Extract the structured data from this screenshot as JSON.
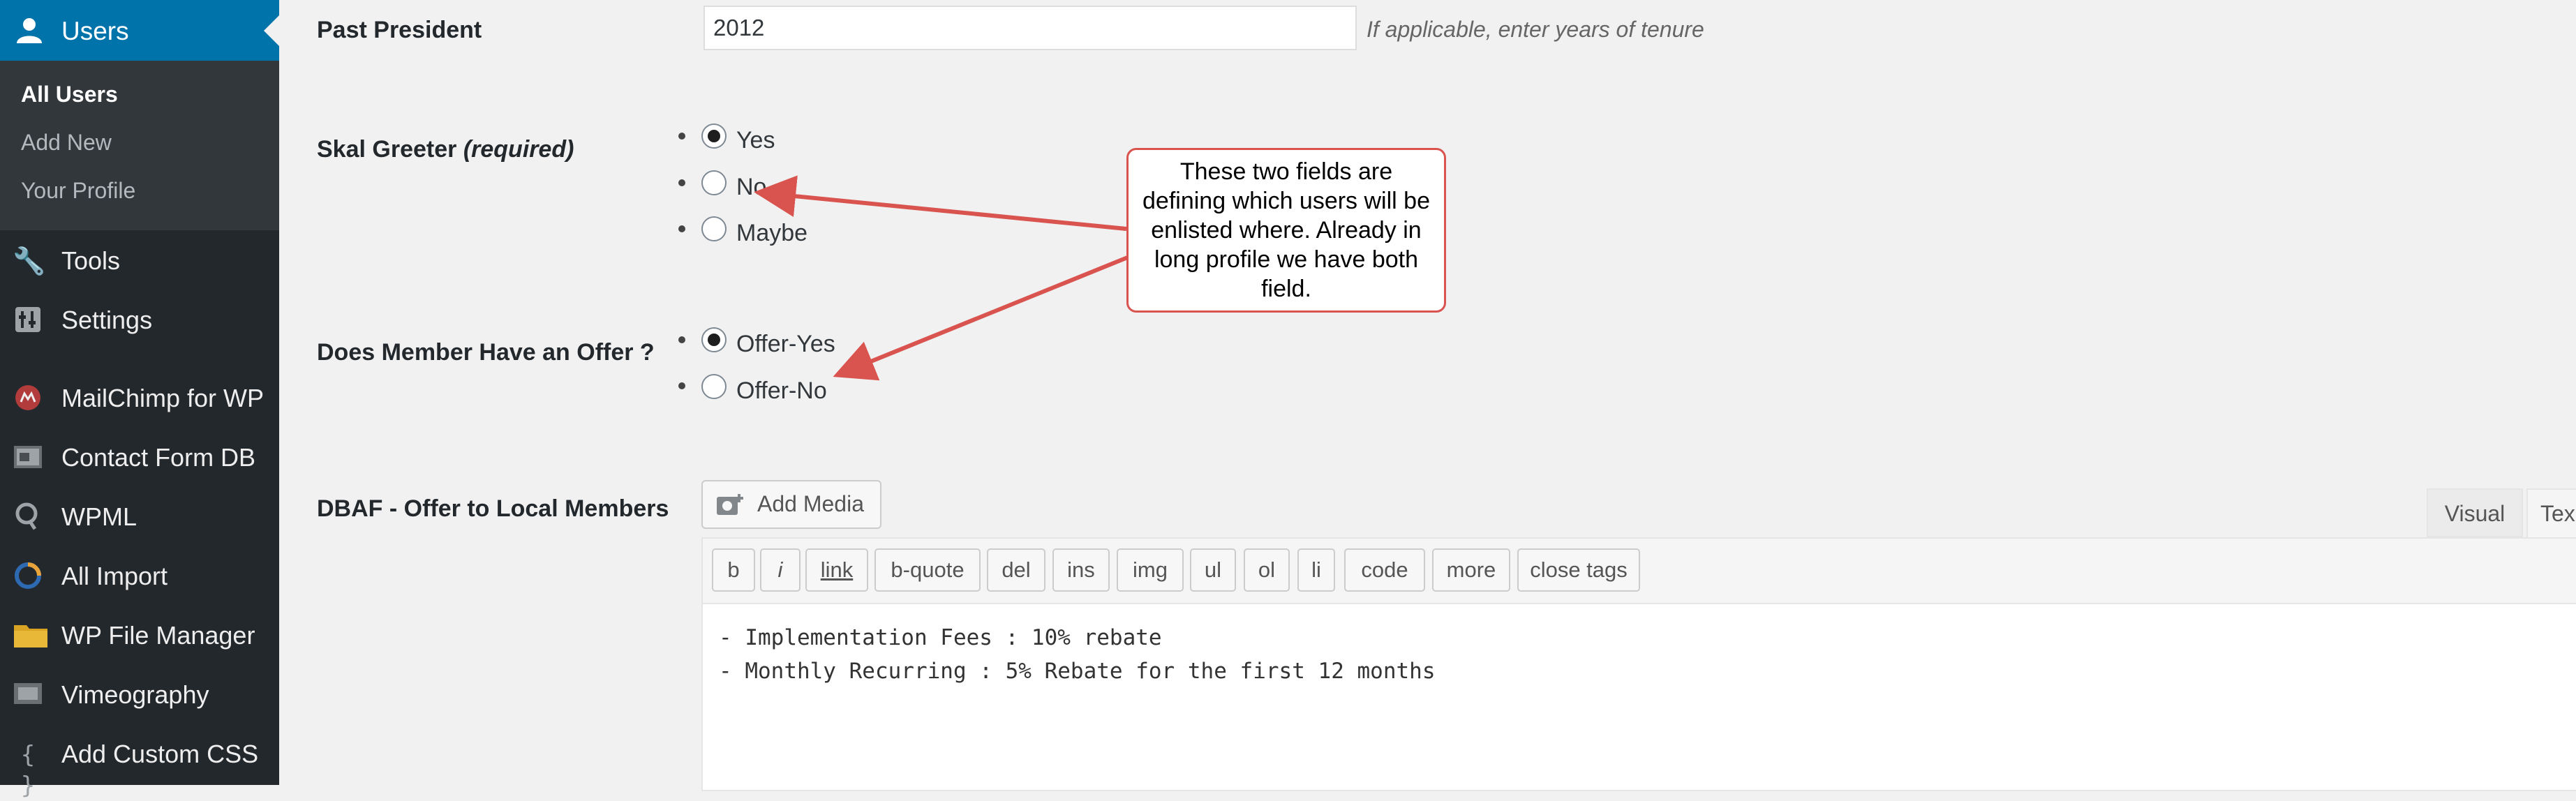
{
  "sidebar": {
    "users_label": "Users",
    "submenu": [
      "All Users",
      "Add New",
      "Your Profile"
    ],
    "items": [
      {
        "label": "Tools",
        "icon": "wrench-icon"
      },
      {
        "label": "Settings",
        "icon": "settings-sliders-icon"
      },
      {
        "label": "MailChimp for WP",
        "icon": "mailchimp-icon"
      },
      {
        "label": "Contact Form DB",
        "icon": "contact-form-db-icon"
      },
      {
        "label": "WPML",
        "icon": "wpml-icon"
      },
      {
        "label": "All Import",
        "icon": "all-import-icon"
      },
      {
        "label": "WP File Manager",
        "icon": "folder-icon"
      },
      {
        "label": "Vimeography",
        "icon": "vimeography-icon"
      },
      {
        "label": "Add Custom CSS",
        "icon": "braces-icon"
      }
    ]
  },
  "form": {
    "past_president": {
      "label": "Past President",
      "value": "2012",
      "hint": "If applicable, enter years of tenure"
    },
    "skal_greeter": {
      "label": "Skal Greeter",
      "required": "(required)",
      "options": [
        "Yes",
        "No",
        "Maybe"
      ],
      "selected": "Yes"
    },
    "member_offer": {
      "label": "Does Member Have an Offer ?",
      "options": [
        "Offer-Yes",
        "Offer-No"
      ],
      "selected": "Offer-Yes"
    },
    "dbaf": {
      "label": "DBAF - Offer to Local Members"
    }
  },
  "callout": {
    "text": "These two fields are defining which users will be enlisted where. Already in long profile we have both field."
  },
  "editor": {
    "add_media": "Add Media",
    "tab_visual": "Visual",
    "tab_text": "Tex",
    "quicktags": [
      "b",
      "i",
      "link",
      "b-quote",
      "del",
      "ins",
      "img",
      "ul",
      "ol",
      "li",
      "code",
      "more",
      "close tags"
    ],
    "content_lines": [
      "- Implementation Fees : 10% rebate",
      "- Monthly Recurring : 5% Rebate for the first 12 months"
    ]
  },
  "colors": {
    "sidebar_bg": "#23282d",
    "active_menu": "#0073aa",
    "callout_border": "#d9534f"
  }
}
